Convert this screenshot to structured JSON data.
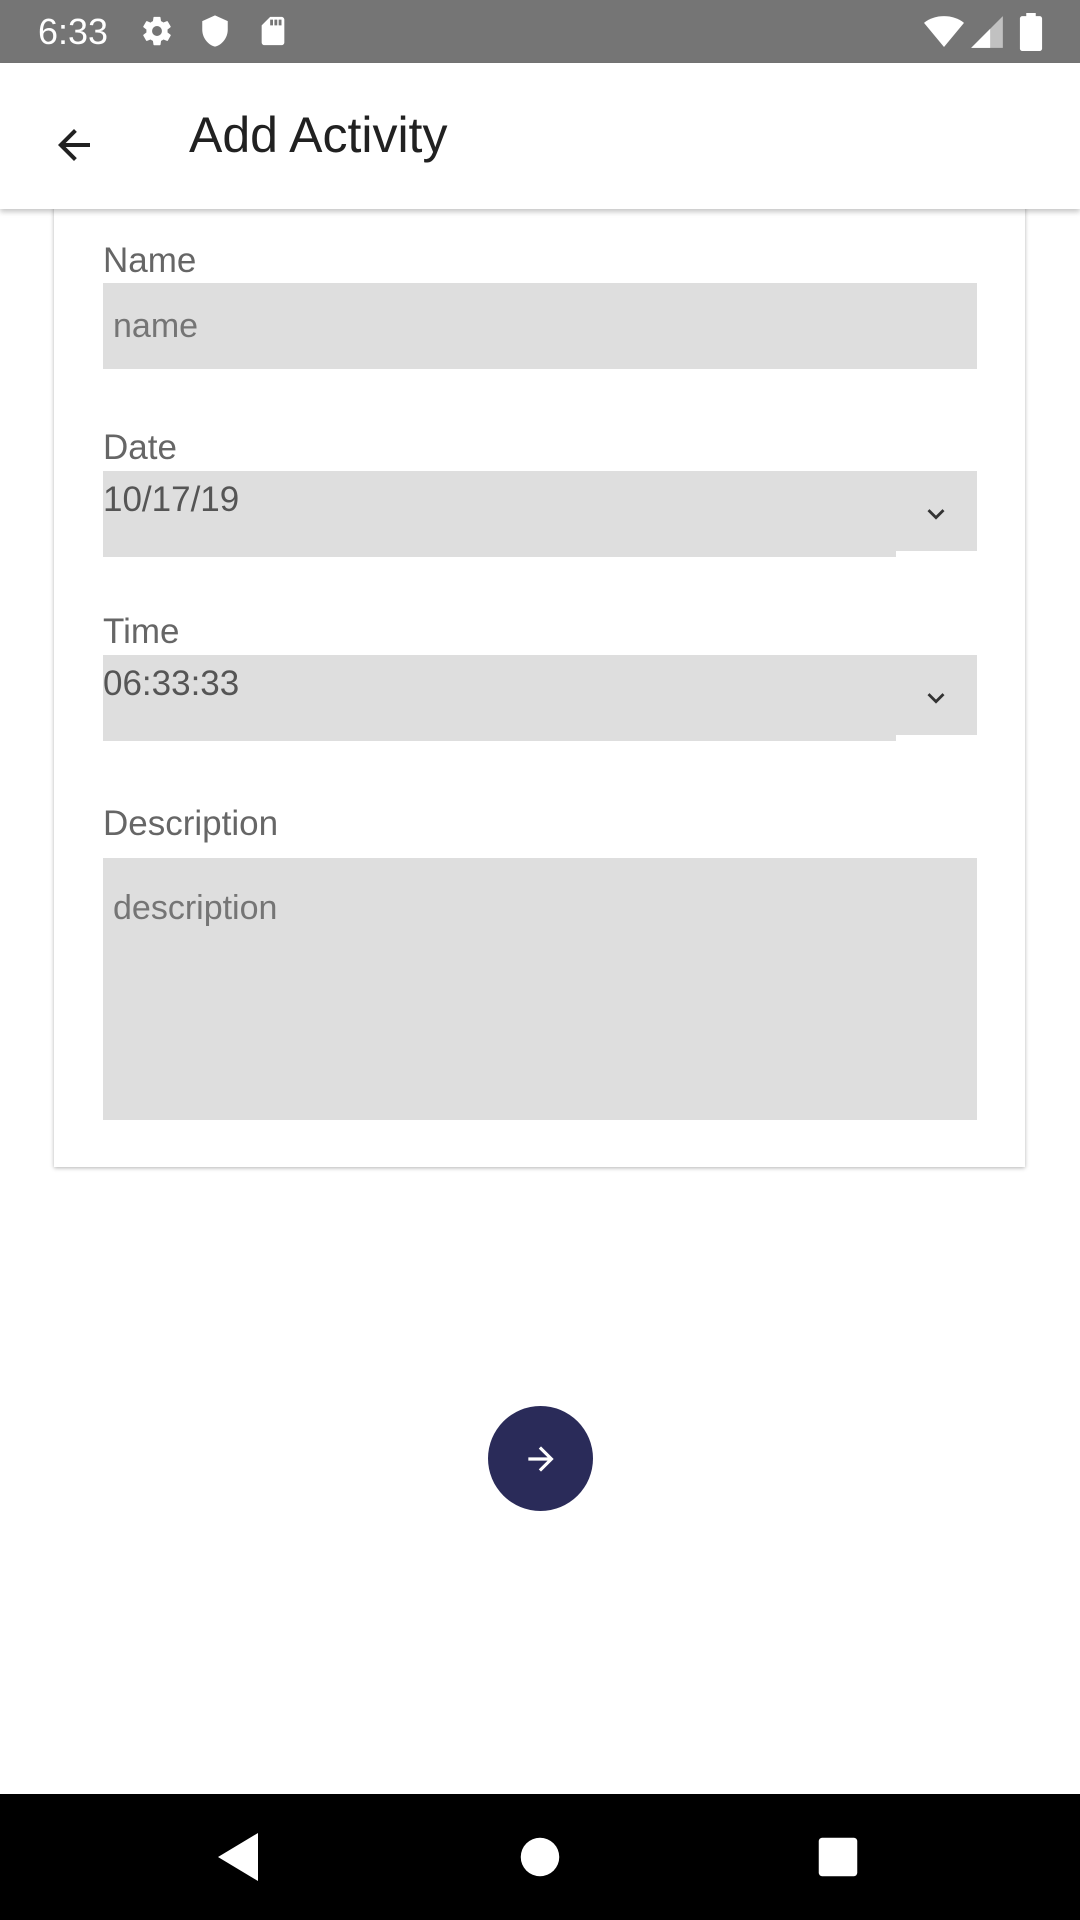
{
  "status_bar": {
    "time": "6:33",
    "left_icons": [
      "gear-icon",
      "shield-icon",
      "sd-card-icon"
    ],
    "right_icons": [
      "wifi-icon",
      "signal-icon",
      "battery-icon"
    ]
  },
  "app_bar": {
    "title": "Add Activity",
    "back_icon": "arrow-left-icon"
  },
  "form": {
    "name": {
      "label": "Name",
      "placeholder": "name",
      "value": ""
    },
    "date": {
      "label": "Date",
      "value": "10/17/19"
    },
    "time": {
      "label": "Time",
      "value": "06:33:33"
    },
    "description": {
      "label": "Description",
      "placeholder": "description",
      "value": ""
    }
  },
  "fab": {
    "icon": "arrow-right-icon",
    "color": "#2a2b59"
  },
  "nav_bar": {
    "buttons": [
      "back-triangle-icon",
      "home-circle-icon",
      "recents-square-icon"
    ]
  }
}
